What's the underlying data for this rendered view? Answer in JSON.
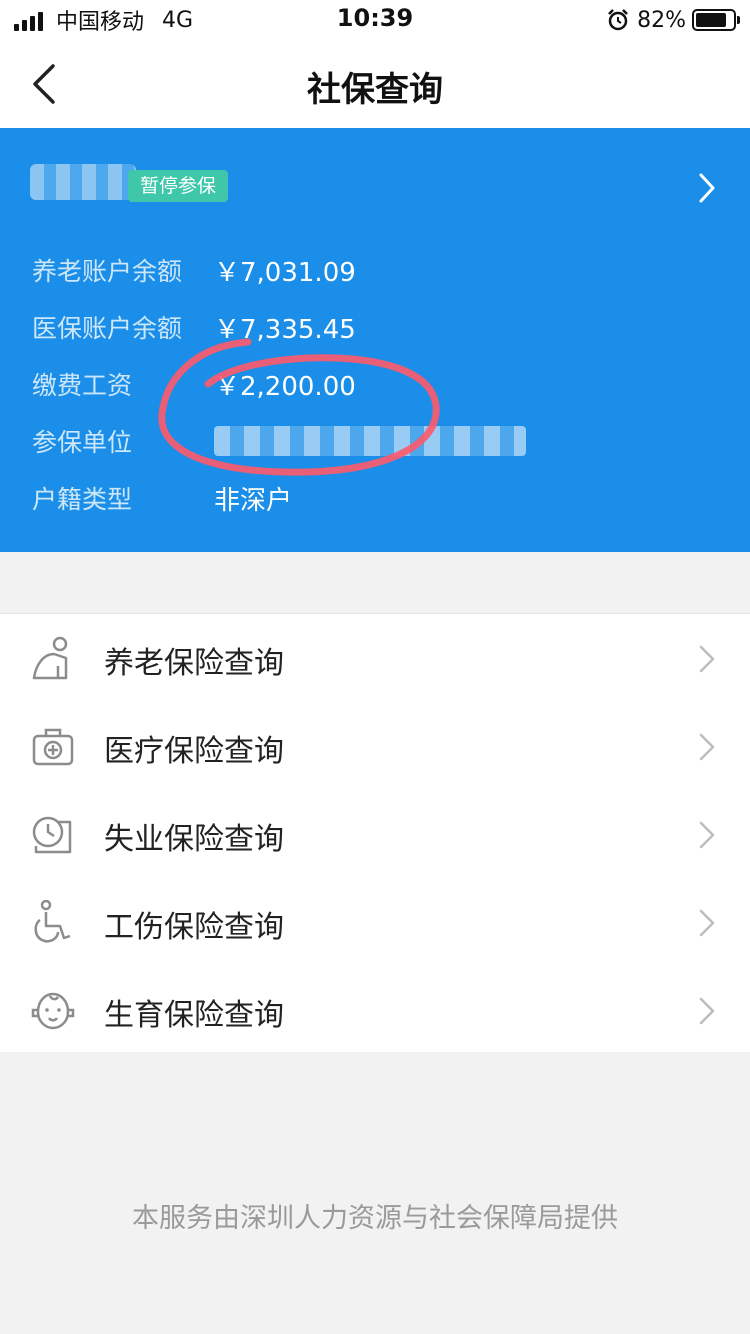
{
  "status_bar": {
    "carrier": "中国移动",
    "network": "4G",
    "time": "10:39",
    "battery": "82%",
    "battery_level": 0.82,
    "icons": [
      "signal-icon",
      "alarm-icon",
      "battery-icon"
    ]
  },
  "nav": {
    "title": "社保查询",
    "back_icon": "chevron-left-icon"
  },
  "card": {
    "badge": "暂停参保",
    "accent_color": "#1a8ee8",
    "badge_color": "#3ec7a8",
    "rows": [
      {
        "label": "养老账户余额",
        "value": "￥7,031.09"
      },
      {
        "label": "医保账户余额",
        "value": "￥7,335.45"
      },
      {
        "label": "缴费工资",
        "value": "￥2,200.00"
      },
      {
        "label": "参保单位",
        "value": ""
      },
      {
        "label": "户籍类型",
        "value": "非深户"
      }
    ]
  },
  "menu": {
    "items": [
      {
        "label": "养老保险查询",
        "icon": "elderly-person-icon"
      },
      {
        "label": "医疗保险查询",
        "icon": "medical-kit-icon"
      },
      {
        "label": "失业保险查询",
        "icon": "clock-icon"
      },
      {
        "label": "工伤保险查询",
        "icon": "wheelchair-icon"
      },
      {
        "label": "生育保险查询",
        "icon": "baby-face-icon"
      }
    ]
  },
  "footer": {
    "text": "本服务由深圳人力资源与社会保障局提供"
  }
}
